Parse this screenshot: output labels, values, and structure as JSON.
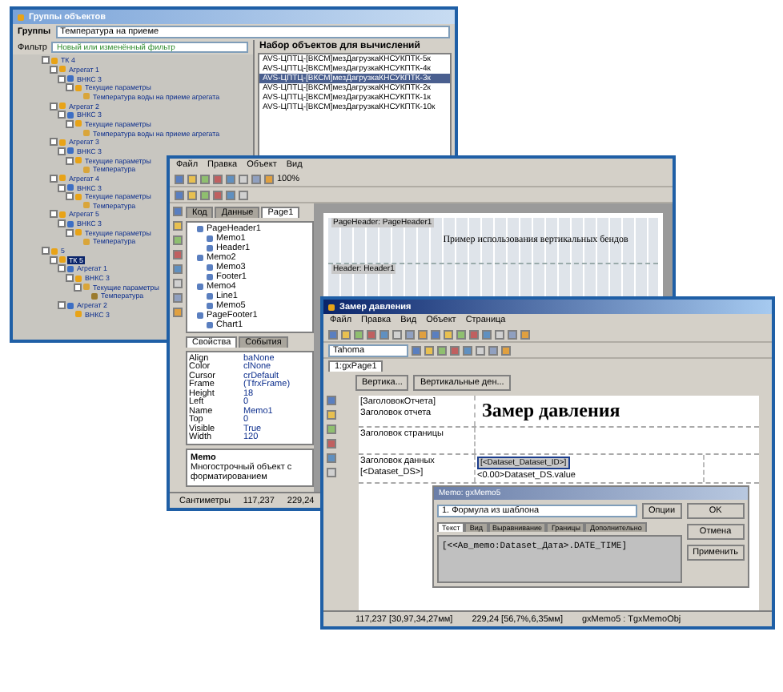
{
  "groups_window": {
    "title": "Группы объектов",
    "group_label": "Группы",
    "group_value": "Температура на приеме",
    "filter_label": "Фильтр",
    "filter_placeholder": "Новый или изменённый фильтр",
    "tree": [
      {
        "label": "ТК 4",
        "selected": false,
        "children": [
          {
            "label": "Агрегат 1",
            "selected": false,
            "children": [
              {
                "label": "ВНКС 3",
                "selected": false,
                "children": [
                  {
                    "label": "Текущие параметры",
                    "selected": false,
                    "children": [
                      {
                        "label": "Температура воды на приеме агрегата",
                        "selected": false
                      }
                    ]
                  }
                ]
              }
            ]
          },
          {
            "label": "Агрегат 2",
            "selected": false,
            "children": [
              {
                "label": "ВНКС 3",
                "selected": false,
                "children": [
                  {
                    "label": "Текущие параметры",
                    "selected": false,
                    "children": [
                      {
                        "label": "Температура воды на приеме агрегата",
                        "selected": false
                      }
                    ]
                  }
                ]
              }
            ]
          },
          {
            "label": "Агрегат 3",
            "selected": false,
            "children": [
              {
                "label": "ВНКС 3",
                "selected": false,
                "children": [
                  {
                    "label": "Текущие параметры",
                    "selected": false,
                    "children": [
                      {
                        "label": "Температура",
                        "selected": false
                      }
                    ]
                  }
                ]
              }
            ]
          },
          {
            "label": "Агрегат 4",
            "selected": false,
            "children": [
              {
                "label": "ВНКС 3",
                "selected": false,
                "children": [
                  {
                    "label": "Текущие параметры",
                    "selected": false,
                    "children": [
                      {
                        "label": "Температура",
                        "selected": false
                      }
                    ]
                  }
                ]
              }
            ]
          },
          {
            "label": "Агрегат 5",
            "selected": false,
            "children": [
              {
                "label": "ВНКС 3",
                "selected": false,
                "children": [
                  {
                    "label": "Текущие параметры",
                    "selected": false,
                    "children": [
                      {
                        "label": "Температура",
                        "selected": false
                      }
                    ]
                  }
                ]
              }
            ]
          }
        ]
      },
      {
        "label": "5",
        "selected": false,
        "children": [
          {
            "label": "ТК 5",
            "selected": true,
            "children": [
              {
                "label": "Агрегат 1",
                "selected": false,
                "children": [
                  {
                    "label": "ВНКС 3",
                    "selected": false,
                    "children": [
                      {
                        "label": "Текущие параметры",
                        "selected": false,
                        "children": [
                          {
                            "label": "Температура",
                            "selected": false
                          }
                        ]
                      }
                    ]
                  }
                ]
              },
              {
                "label": "Агрегат 2",
                "selected": false,
                "children": [
                  {
                    "label": "ВНКС 3",
                    "selected": false
                  }
                ]
              }
            ]
          }
        ]
      }
    ],
    "list_header": "Набор объектов для вычислений",
    "list_rows": [
      {
        "text": "AVS-ЦПТЦ-[ВКСМ]мезДагрузкаКНСУКПТК-5к",
        "selected": false
      },
      {
        "text": "AVS-ЦПТЦ-[ВКСМ]мезДагрузкаКНСУКПТК-4к",
        "selected": false
      },
      {
        "text": "AVS-ЦПТЦ-[ВКСМ]мезДагрузкаКНСУКПТК-3к",
        "selected": true
      },
      {
        "text": "AVS-ЦПТЦ-[ВКСМ]мезДагрузкаКНСУКПТК-2к",
        "selected": false
      },
      {
        "text": "AVS-ЦПТЦ-[ВКСМ]мезДагрузкаКНСУКПТК-1к",
        "selected": false
      },
      {
        "text": "AVS-ЦПТЦ-[ВКСМ]мезДагрузкаКНСУКПТК-10к",
        "selected": false
      }
    ]
  },
  "designer_window": {
    "menu": [
      "Файл",
      "Правка",
      "Объект",
      "Вид"
    ],
    "zoom": "100%",
    "tabs": [
      {
        "label": "Код",
        "selected": false
      },
      {
        "label": "Данные",
        "selected": false
      },
      {
        "label": "Page1",
        "selected": true
      }
    ],
    "tree": [
      "PageHeader1",
      "Memo1",
      "Header1",
      "Memo2",
      "Memo3",
      "Footer1",
      "Memo4",
      "Line1",
      "Memo5",
      "PageFooter1",
      "Chart1"
    ],
    "props_tabs": [
      {
        "label": "Свойства",
        "selected": true
      },
      {
        "label": "События",
        "selected": false
      }
    ],
    "props": [
      [
        "Align",
        "baNone"
      ],
      [
        "Color",
        "clNone"
      ],
      [
        "Cursor",
        "crDefault"
      ],
      [
        "Frame",
        "(TfrxFrame)"
      ],
      [
        "Height",
        "18"
      ],
      [
        "Left",
        "0"
      ],
      [
        "Name",
        "Memo1"
      ],
      [
        "Top",
        "0"
      ],
      [
        "Visible",
        "True"
      ],
      [
        "Width",
        "120"
      ]
    ],
    "help_title": "Memo",
    "help_text": "Многострочный объект с форматированием",
    "page_title": "Пример использования вертикальных бендов",
    "bands": [
      "PageHeader: PageHeader1",
      "Header: Header1"
    ],
    "status": [
      "Сантиметры",
      "117,237",
      "229,24"
    ]
  },
  "report_window": {
    "title": "Замер давления",
    "menu": [
      "Файл",
      "Правка",
      "Вид",
      "Объект",
      "Страница"
    ],
    "font": "Tahoma",
    "page_tab": "1:gxPage1",
    "band_buttons": [
      "Вертика...",
      "Вертикальные ден..."
    ],
    "heading": "Замер давления",
    "header_field": "[ЗаголовокОтчета]",
    "band_labels": [
      "Заголовок отчета",
      "Заголовок страницы",
      "Заголовок данных"
    ],
    "data_field": "[<Dataset_DS>]",
    "value_field": "<0.00>Dataset_DS.value",
    "selected_field": "[<Dataset_Dataset_ID>]",
    "dialog": {
      "title": "Memo: gxMemo5",
      "template": "1. Формула из шаблона",
      "buttons": [
        "OK",
        "Отмена",
        "Применить"
      ],
      "extra_button": "Опции",
      "tabs": [
        {
          "label": "Текст",
          "selected": true
        },
        {
          "label": "Вид",
          "selected": false
        },
        {
          "label": "Выравнивание",
          "selected": false
        },
        {
          "label": "Границы",
          "selected": false
        },
        {
          "label": "Дополнительно",
          "selected": false
        }
      ],
      "text": "[<<Ав_memo:Dataset_Дата>.DATE_TIME]"
    },
    "status": [
      "117,237 [30,97,34,27мм]",
      "229,24 [56,7%,6,35мм]",
      "gxMemo5 : TgxMemoObj"
    ]
  }
}
